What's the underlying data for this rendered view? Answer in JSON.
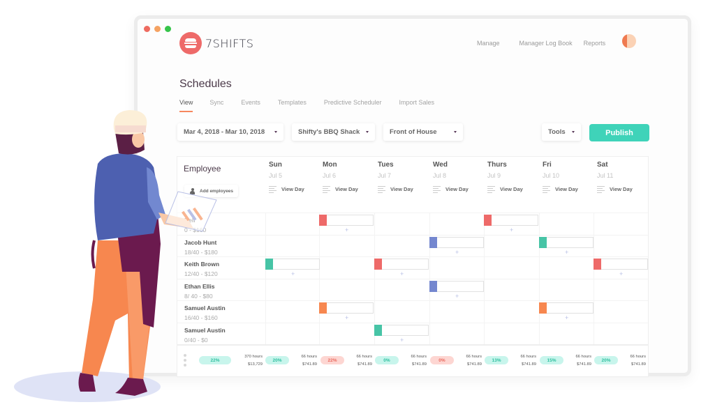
{
  "window": {
    "traffic_lights": [
      {
        "name": "close",
        "color": "#ee6b60"
      },
      {
        "name": "minimize",
        "color": "#f5a262"
      },
      {
        "name": "maximize",
        "color": "#36c44a"
      }
    ]
  },
  "brand": {
    "name": "7SHIFTS",
    "logo_icon": "burger-icon",
    "color": "#ee6a69"
  },
  "topnav": {
    "items": [
      "Manage",
      "Manager Log Book",
      "Reports"
    ],
    "avatar": "user-avatar"
  },
  "page": {
    "title": "Schedules",
    "tabs": [
      {
        "label": "View",
        "active": true
      },
      {
        "label": "Sync",
        "active": false
      },
      {
        "label": "Events",
        "active": false
      },
      {
        "label": "Templates",
        "active": false
      },
      {
        "label": "Predictive Scheduler",
        "active": false
      },
      {
        "label": "Import Sales",
        "active": false
      }
    ]
  },
  "filters": {
    "date_range": "Mar 4, 2018 - Mar 10, 2018",
    "location": "Shifty's BBQ Shack",
    "department": "Front of House",
    "tools": "Tools",
    "publish": "Publish",
    "publish_color": "#3fd3b9"
  },
  "schedule": {
    "employee_header": "Employee",
    "add_employees": "Add employees",
    "view_day_label": "View Day",
    "days": [
      {
        "name": "Sun",
        "date": "Jul 5"
      },
      {
        "name": "Mon",
        "date": "Jul 6"
      },
      {
        "name": "Tues",
        "date": "Jul 7"
      },
      {
        "name": "Wed",
        "date": "Jul 8"
      },
      {
        "name": "Thurs",
        "date": "Jul 9"
      },
      {
        "name": "Fri",
        "date": "Jul 10"
      },
      {
        "name": "Sat",
        "date": "Jul 11"
      }
    ],
    "role_colors": {
      "red": "#ee6a69",
      "teal": "#47c4a6",
      "blue": "#7487cf",
      "orange": "#f7874f"
    },
    "employees": [
      {
        "name": "Bell",
        "stats": "0 - $160",
        "shifts": [
          {
            "day": 1,
            "color": "red"
          },
          {
            "day": 4,
            "color": "red"
          }
        ]
      },
      {
        "name": "Jacob Hunt",
        "stats": "18/40 - $180",
        "shifts": [
          {
            "day": 3,
            "color": "blue"
          },
          {
            "day": 5,
            "color": "teal"
          }
        ]
      },
      {
        "name": "Keith Brown",
        "stats": "12/40 - $120",
        "shifts": [
          {
            "day": 0,
            "color": "teal"
          },
          {
            "day": 2,
            "color": "red"
          },
          {
            "day": 6,
            "color": "red"
          }
        ]
      },
      {
        "name": "Ethan Ellis",
        "stats": "8/ 40 - $80",
        "shifts": [
          {
            "day": 3,
            "color": "blue"
          }
        ]
      },
      {
        "name": "Samuel Austin",
        "stats": "16/40 - $160",
        "shifts": [
          {
            "day": 1,
            "color": "orange"
          },
          {
            "day": 5,
            "color": "orange"
          }
        ]
      },
      {
        "name": "Samuel Austin",
        "stats": "0/40 - $0",
        "shifts": [
          {
            "day": 2,
            "color": "teal"
          }
        ]
      }
    ],
    "footer": {
      "total_pill": {
        "value": "22%",
        "tone": "green"
      },
      "total_hours": "370 hours",
      "total_cost": "$13,729",
      "days": [
        {
          "pill": "20%",
          "tone": "green",
          "hours": "66 hours",
          "cost": "$741.89"
        },
        {
          "pill": "22%",
          "tone": "red",
          "hours": "66 hours",
          "cost": "$741.89"
        },
        {
          "pill": "0%",
          "tone": "green",
          "hours": "66 hours",
          "cost": "$741.89"
        },
        {
          "pill": "0%",
          "tone": "red",
          "hours": "66 hours",
          "cost": "$741.89"
        },
        {
          "pill": "13%",
          "tone": "green",
          "hours": "66 hours",
          "cost": "$741.89"
        },
        {
          "pill": "15%",
          "tone": "green",
          "hours": "66 hours",
          "cost": "$741.89"
        },
        {
          "pill": "20%",
          "tone": "green",
          "hours": "66 hours",
          "cost": "$741.89"
        }
      ]
    }
  },
  "illustration": {
    "subject": "chef-with-tablet-illustration"
  }
}
